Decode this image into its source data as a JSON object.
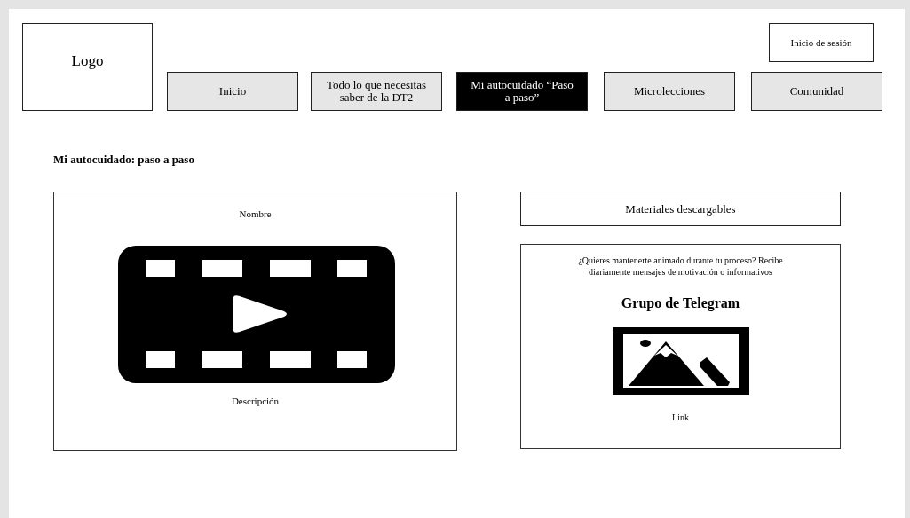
{
  "logo": {
    "label": "Logo"
  },
  "login_button": {
    "label": "Inicio de sesión"
  },
  "nav": [
    {
      "label": "Inicio",
      "selected": false
    },
    {
      "label": "Todo lo que necesitas saber de la DT2",
      "selected": false
    },
    {
      "label": "Mi autocuidado “Paso a paso”",
      "selected": true
    },
    {
      "label": "Microlecciones",
      "selected": false
    },
    {
      "label": "Comunidad",
      "selected": false
    }
  ],
  "heading": "Mi autocuidado: paso a paso",
  "video_card": {
    "name": "Nombre",
    "description": "Descripción"
  },
  "downloads_button": {
    "label": "Materiales descargables"
  },
  "telegram_card": {
    "text": "¿Quieres mantenerte animado durante tu proceso? Recibe diariamente mensajes de motivación o informativos",
    "title": "Grupo de Telegram",
    "link": "Link"
  }
}
